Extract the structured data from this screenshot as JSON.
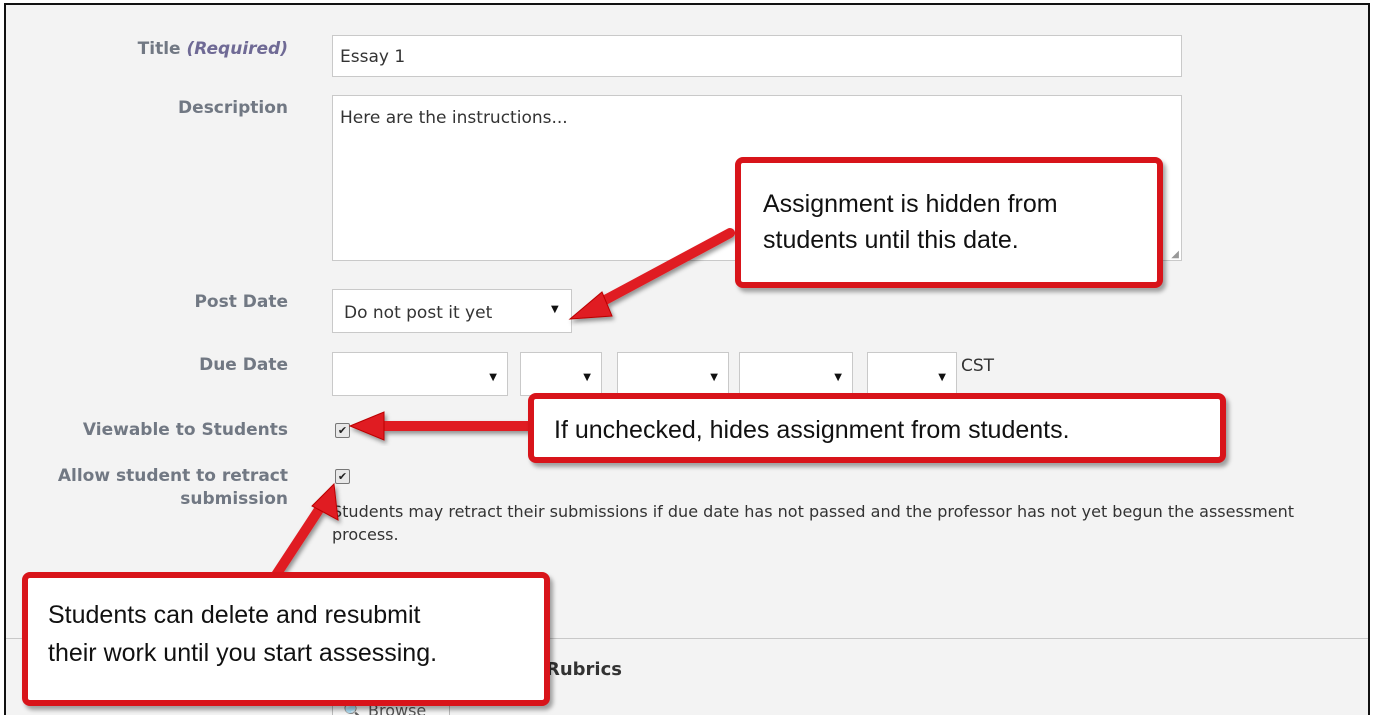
{
  "form": {
    "title_label": "Title ",
    "title_required": "(Required)",
    "title_value": "Essay 1",
    "description_label": "Description",
    "description_value": "Here are the instructions...",
    "post_date_label": "Post Date",
    "post_date_value": "Do not post it yet",
    "due_date_label": "Due Date",
    "due_date_timezone": "CST",
    "viewable_label": "Viewable to Students",
    "retract_label_line1": "Allow student to retract",
    "retract_label_line2": "submission",
    "retract_help": "Students may retract their submissions if due date has not passed and the professor has not yet begun the assessment process.",
    "rubrics_heading": "Rubrics",
    "browse_button": "Browse"
  },
  "callouts": {
    "post_date_line1": "Assignment is hidden from",
    "post_date_line2": "students until this date.",
    "viewable": "If unchecked, hides assignment from students.",
    "retract_line1": "Students can delete and resubmit",
    "retract_line2": "their work until you start assessing."
  },
  "state": {
    "viewable_checked": true,
    "retract_checked": true
  },
  "colors": {
    "callout_border": "#d8141a",
    "label_text": "#717883",
    "required_text": "#6f6a95"
  }
}
